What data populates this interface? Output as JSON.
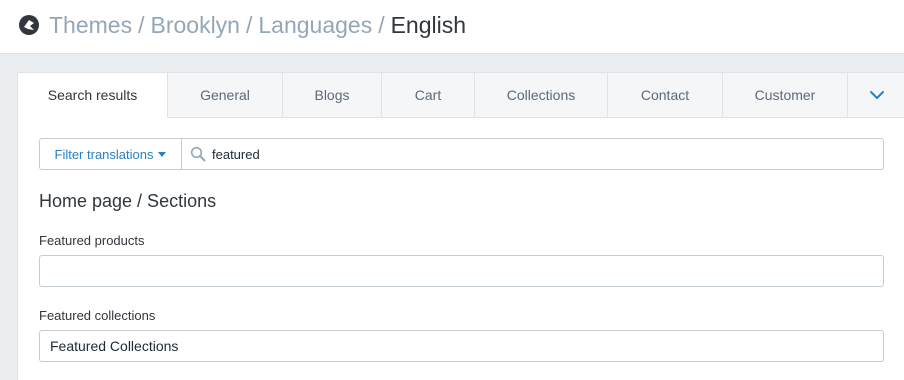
{
  "header": {
    "logo_icon": "shopify-logo-icon",
    "breadcrumb": [
      "Themes",
      "Brooklyn",
      "Languages"
    ],
    "separator": "/",
    "current": "English"
  },
  "tabs": [
    {
      "label": "Search results",
      "active": true
    },
    {
      "label": "General",
      "active": false
    },
    {
      "label": "Blogs",
      "active": false
    },
    {
      "label": "Cart",
      "active": false
    },
    {
      "label": "Collections",
      "active": false
    },
    {
      "label": "Contact",
      "active": false
    },
    {
      "label": "Customer",
      "active": false
    }
  ],
  "more_tabs_icon": "chevron-down-icon",
  "filter": {
    "button_label": "Filter translations",
    "search_icon": "search-icon",
    "search_value": "featured"
  },
  "section": {
    "title": "Home page / Sections",
    "fields": [
      {
        "label": "Featured products",
        "value": ""
      },
      {
        "label": "Featured collections",
        "value": "Featured Collections"
      }
    ]
  },
  "colors": {
    "accent": "#2780c4",
    "muted_text": "#95a7b7",
    "background": "#ebeef0"
  }
}
